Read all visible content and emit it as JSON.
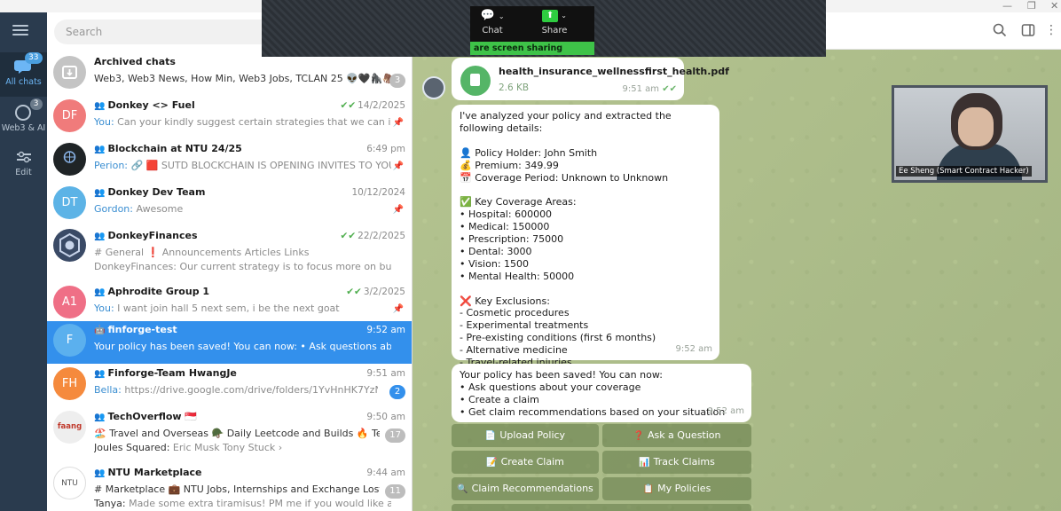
{
  "share_overlay": {
    "chat_label": "Chat",
    "share_label": "Share",
    "strip_text": "are screen sharing"
  },
  "rail": {
    "folders": [
      {
        "label": "All chats",
        "badge": "33"
      },
      {
        "label": "Web3 & AI",
        "badge": "3"
      },
      {
        "label": "Edit",
        "badge": ""
      }
    ]
  },
  "search": {
    "placeholder": "Search"
  },
  "chats": [
    {
      "title": "Archived chats",
      "time": "",
      "preview": "Web3, Web3 News, How Min, Web3 Jobs, TCLAN 25 👽🖤🦍🦣 ...",
      "sender": "",
      "badge": "3",
      "avatar_text": "",
      "avatar_color": "#c4c4c4"
    },
    {
      "title": "Donkey <> Fuel",
      "time": "14/2/2025",
      "preview": "Can your kindly suggest certain strategies that we can impleme...",
      "sender": "You:",
      "badge": "",
      "avatar_text": "DF",
      "avatar_color": "#f07b7b"
    },
    {
      "title": "Blockchain at NTU 24/25",
      "time": "6:49 pm",
      "preview": "🔗 🟥 SUTD BLOCKCHAIN IS OPENING INVITES TO YOU!! 📣",
      "sender": "Perion:",
      "badge": "",
      "avatar_text": "",
      "avatar_color": "#1f2426"
    },
    {
      "title": "Donkey Dev Team",
      "time": "10/12/2024",
      "preview": "Awesome",
      "sender": "Gordon:",
      "badge": "",
      "avatar_text": "DT",
      "avatar_color": "#5cb3e6"
    },
    {
      "title": "DonkeyFinances",
      "time": "22/2/2025",
      "preview": "# General  ❗ Announcements  Articles  Links",
      "preview2": "Our current strategy is to focus more on building t...",
      "sender": "",
      "sender2": "DonkeyFinances:",
      "badge": "",
      "avatar_text": "",
      "avatar_color": "#3a4a66"
    },
    {
      "title": "Aphrodite Group 1",
      "time": "3/2/2025",
      "preview": "I want join hall 5 next sem, i be the next goat",
      "sender": "You:",
      "badge": "",
      "avatar_text": "A1",
      "avatar_color": "#ef6f86"
    },
    {
      "title": "finforge-test",
      "time": "9:52 am",
      "preview": "Your policy has been saved! You can now: • Ask questions about your co...",
      "sender": "",
      "badge": "",
      "avatar_text": "F",
      "avatar_color": "#5bb0ee"
    },
    {
      "title": "Finforge-Team HwangJe",
      "time": "9:51 am",
      "preview": "https://drive.google.com/drive/folders/1YvHnHK7YzN5mYU7v...",
      "sender": "Bella:",
      "badge": "2",
      "avatar_text": "FH",
      "avatar_color": "#f58a3d"
    },
    {
      "title": "TechOverflow 🇸🇬",
      "time": "9:50 am",
      "preview": "🏖️ Travel and Overseas  🪖 Daily Leetcode and Builds  🔥 Techn...",
      "preview2": "Eric Musk Tony Stuck ›",
      "sender": "",
      "sender2": "Joules Squared:",
      "badge": "17",
      "avatar_text": "faang",
      "avatar_color": "#eeeeee"
    },
    {
      "title": "NTU Marketplace",
      "time": "9:44 am",
      "preview": "# Marketplace  💼 NTU Jobs, Internships and Exchange  Lost & F...",
      "preview2": "Made some extra tiramisus! PM me if you would like an...",
      "sender": "",
      "sender2": "Tanya:",
      "badge": "11",
      "avatar_text": "NTU",
      "avatar_color": "#ffffff"
    }
  ],
  "messages": {
    "file": {
      "name": "health_insurance_wellnessfirst_health.pdf",
      "size": "2.6 KB",
      "time": "9:51 am"
    },
    "analysis": {
      "lines": [
        "I've analyzed your policy and extracted the following details:",
        "",
        "👤 Policy Holder: John Smith",
        "💰 Premium: 349.99",
        "📅 Coverage Period: Unknown to Unknown",
        "",
        "✅ Key Coverage Areas:",
        "• Hospital: 600000",
        "• Medical: 150000",
        "• Prescription: 75000",
        "• Dental: 3000",
        "• Vision: 1500",
        "• Mental Health: 50000",
        "",
        "❌ Key Exclusions:",
        "- Cosmetic procedures",
        "- Experimental treatments",
        "- Pre-existing conditions (first 6 months)",
        "- Alternative medicine",
        "- Travel-related injuries"
      ],
      "time": "9:52 am"
    },
    "saved": {
      "lines": [
        "Your policy has been saved! You can now:",
        "• Ask questions about your coverage",
        "• Create a claim",
        "• Get claim recommendations based on your situation"
      ],
      "time": "9:52 am"
    }
  },
  "keyboard": [
    {
      "label": "Upload Policy",
      "icon": "📄"
    },
    {
      "label": "Ask a Question",
      "icon": "❓"
    },
    {
      "label": "Create Claim",
      "icon": "📝"
    },
    {
      "label": "Track Claims",
      "icon": "📊"
    },
    {
      "label": "Claim Recommendations",
      "icon": "🔍"
    },
    {
      "label": "My Policies",
      "icon": "📋"
    }
  ],
  "video": {
    "label": "Ee Sheng (Smart Contract Hacker)"
  }
}
